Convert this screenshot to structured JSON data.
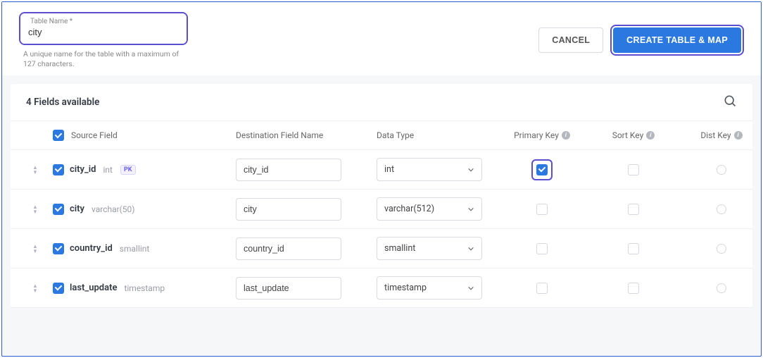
{
  "form": {
    "table_name_label": "Table Name *",
    "table_name_value": "city",
    "helper": "A unique name for the table with a maximum of 127 characters.",
    "cancel_label": "CANCEL",
    "submit_label": "CREATE TABLE & MAP"
  },
  "fields": {
    "count_label": "4 Fields available",
    "headers": {
      "source": "Source Field",
      "dest": "Destination Field Name",
      "datatype": "Data Type",
      "pk": "Primary Key",
      "sortkey": "Sort Key",
      "distkey": "Dist Key"
    },
    "rows": [
      {
        "source_name": "city_id",
        "source_type": "int",
        "pk_badge": "PK",
        "dest": "city_id",
        "datatype": "int",
        "primary_checked": true,
        "primary_highlighted": true
      },
      {
        "source_name": "city",
        "source_type": "varchar(50)",
        "pk_badge": "",
        "dest": "city",
        "datatype": "varchar(512)",
        "primary_checked": false,
        "primary_highlighted": false
      },
      {
        "source_name": "country_id",
        "source_type": "smallint",
        "pk_badge": "",
        "dest": "country_id",
        "datatype": "smallint",
        "primary_checked": false,
        "primary_highlighted": false
      },
      {
        "source_name": "last_update",
        "source_type": "timestamp",
        "pk_badge": "",
        "dest": "last_update",
        "datatype": "timestamp",
        "primary_checked": false,
        "primary_highlighted": false
      }
    ]
  }
}
